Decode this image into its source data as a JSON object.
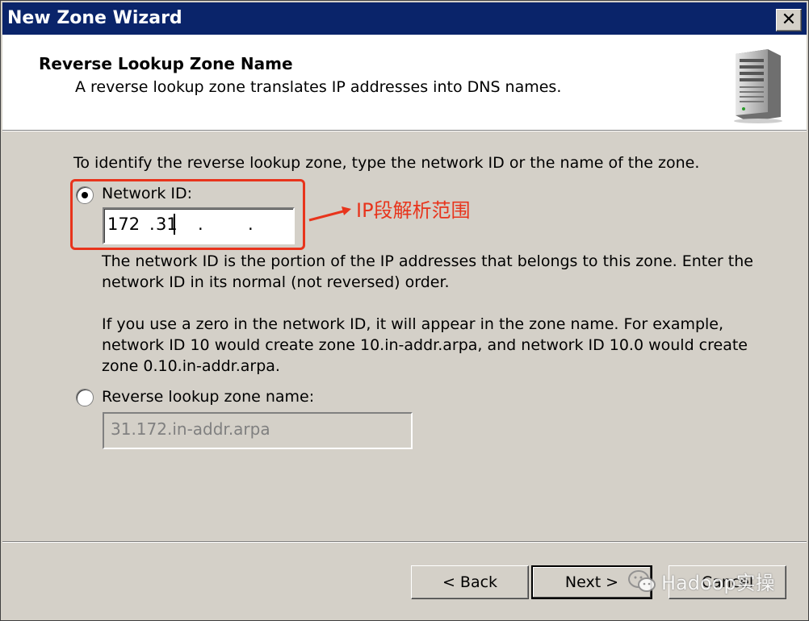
{
  "window": {
    "title": "New Zone Wizard"
  },
  "header": {
    "title": "Reverse Lookup Zone Name",
    "subtitle": "A reverse lookup zone translates IP addresses into DNS names."
  },
  "body": {
    "intro": "To identify the reverse lookup zone, type the network ID or the name of the zone.",
    "network_id": {
      "label": "Network ID:",
      "selected": true,
      "octet1": "172",
      "octet2": "31",
      "octet3": "",
      "octet4": ""
    },
    "help1_line1": "The network ID is the portion of the IP addresses that belongs to this zone. Enter the",
    "help1_line2": "network ID in its normal (not reversed) order.",
    "help2_line1": "If you use a zero in the network ID, it will appear in the zone name. For example,",
    "help2_line2": "network ID 10 would create zone 10.in-addr.arpa, and network ID 10.0 would create",
    "help2_line3": "zone 0.10.in-addr.arpa.",
    "zone_name": {
      "label": "Reverse lookup zone name:",
      "selected": false,
      "value": "31.172.in-addr.arpa"
    }
  },
  "annotation": {
    "text": "IP段解析范围",
    "color": "#e8341c"
  },
  "buttons": {
    "back": "< Back",
    "next": "Next >",
    "cancel": "Cancel"
  },
  "watermark": {
    "text": "Hadoop实操"
  },
  "colors": {
    "titlebar": "#0a246a",
    "dialog_bg": "#d4d0c8",
    "annotation": "#e8341c"
  }
}
